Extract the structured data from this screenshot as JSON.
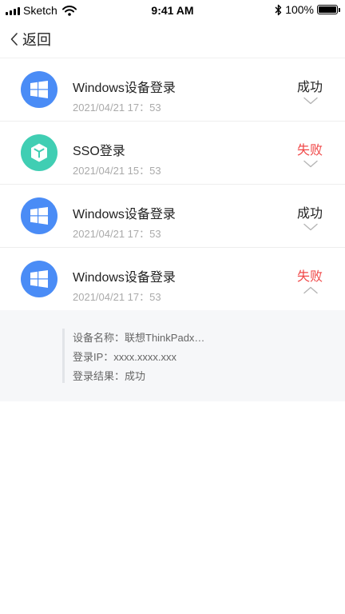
{
  "status_bar": {
    "carrier": "Sketch",
    "time": "9:41 AM",
    "battery_pct": "100%"
  },
  "nav": {
    "back_label": "返回"
  },
  "colors": {
    "success": "#222222",
    "fail": "#f04848",
    "windows_avatar": "#4a8cf6",
    "sso_avatar": "#40ceb3"
  },
  "records": [
    {
      "icon": "windows-icon",
      "title": "Windows设备登录",
      "time": "2021/04/21  17：53",
      "status": "成功",
      "status_type": "success",
      "expanded": false
    },
    {
      "icon": "cube-icon",
      "title": "SSO登录",
      "time": "2021/04/21  15：53",
      "status": "失败",
      "status_type": "fail",
      "expanded": false
    },
    {
      "icon": "windows-icon",
      "title": "Windows设备登录",
      "time": "2021/04/21  17：53",
      "status": "成功",
      "status_type": "success",
      "expanded": false
    },
    {
      "icon": "windows-icon",
      "title": "Windows设备登录",
      "time": "2021/04/21  17：53",
      "status": "失败",
      "status_type": "fail",
      "expanded": true
    }
  ],
  "detail": {
    "device_name": "设备名称：联想ThinkPadx…",
    "login_ip": "登录IP：xxxx.xxxx.xxx",
    "login_result": "登录结果：成功"
  }
}
